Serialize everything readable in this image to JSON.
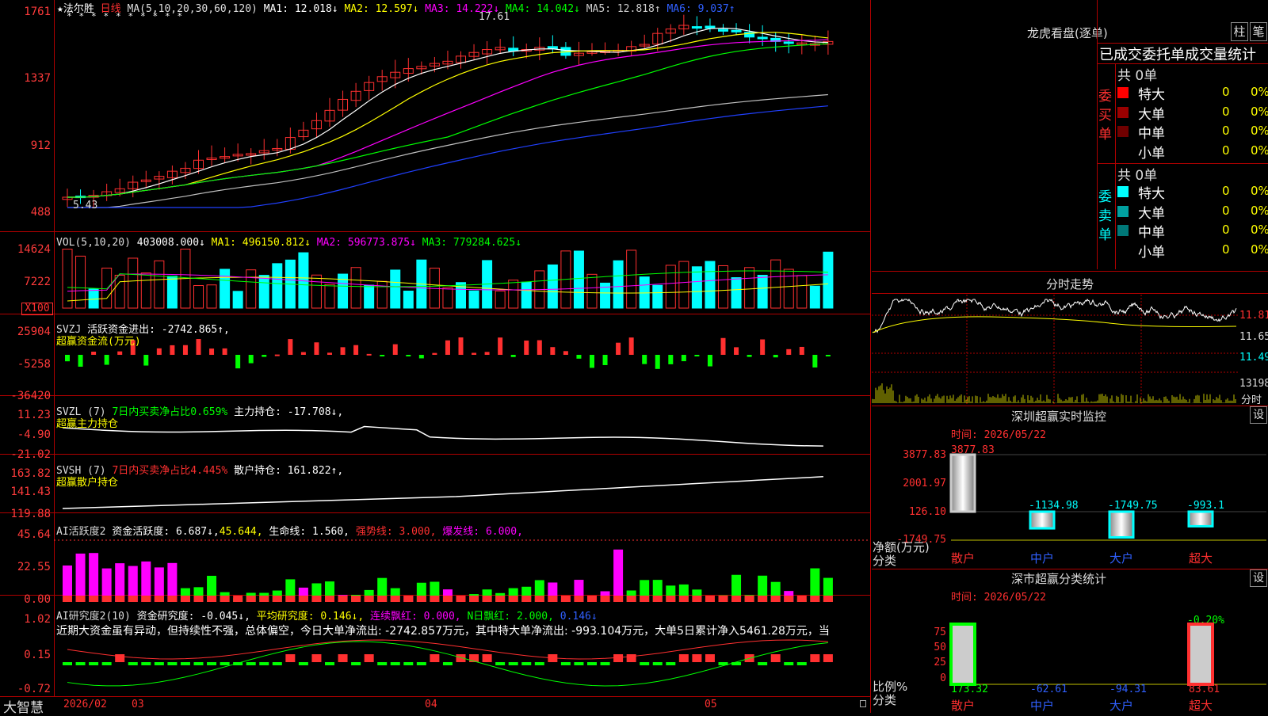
{
  "k_header": {
    "star": "★",
    "name": "法尔胜",
    "period": "日线",
    "ma_title": "MA(5,10,20,30,60,120)",
    "ma1": "MA1: 12.018↓",
    "ma2": "MA2: 12.597↓",
    "ma3": "MA3: 14.222↓",
    "ma4": "MA4: 14.042↓",
    "ma5": "MA5: 12.818↑",
    "ma6": "MA6: 9.037↑",
    "high_mark": "17.61",
    "low_mark": "5.43"
  },
  "k_axis": [
    "1761",
    "1337",
    "912",
    "488"
  ],
  "vol": {
    "title": "VOL(5,10,20)",
    "value": "403008.000↓",
    "ma1": "MA1: 496150.812↓",
    "ma2": "MA2: 596773.875↓",
    "ma3": "MA3: 779284.625↓",
    "axis": [
      "14624",
      "7222"
    ],
    "unit_btn": "X100"
  },
  "svzj": {
    "title": "SVZJ",
    "active": "活跃资金进出: -2742.865↑,",
    "sub": "超赢资金流(万元)",
    "axis": [
      "25904",
      "-5258",
      "-36420"
    ]
  },
  "svzl": {
    "title": "SVZL (7)",
    "ratio": "7日内买卖净占比0.659%",
    "pos": "主力持仓: -17.708↓,",
    "sub": "超赢主力持仓",
    "axis": [
      "11.23",
      "-4.90",
      "-21.02"
    ]
  },
  "svsh": {
    "title": "SVSH (7)",
    "ratio": "7日内买卖净占比4.445%",
    "pos": "散户持仓: 161.822↑,",
    "sub": "超赢散户持仓",
    "axis": [
      "163.82",
      "141.43",
      "119.88"
    ]
  },
  "ai2": {
    "title": "AI活跃度2",
    "act": "资金活跃度: 6.687↓,",
    "v2": "45.644,",
    "life": "生命线: 1.560,",
    "strong": "强势线: 3.000,",
    "burst": "爆发线: 6.000,",
    "axis": [
      "45.64",
      "22.55",
      "0.00"
    ]
  },
  "ai_res": {
    "title": "AI研究度2(10)",
    "res": "资金研究度: -0.045↓,",
    "avg": "平均研究度: 0.146↓,",
    "cont": "连续飘红: 0.000,",
    "nday": "N日飘红: 2.000,",
    "last": "0.146↓",
    "comment": "近期大资金虽有异动，但持续性不强，总体偏空，今日大单净流出: -2742.857万元，其中特大单净流出: -993.104万元，大单5日累计净入5461.28万元，当",
    "axis": [
      "1.02",
      "0.15",
      "-0.72"
    ]
  },
  "bottom": {
    "brand": "大智慧",
    "dates": [
      "2026/02",
      "03",
      "04",
      "05"
    ]
  },
  "longhu": {
    "title": "龙虎看盘(逐单)",
    "btn1": "柱",
    "btn2": "笔",
    "table_title": "已成交委托单成交量统计",
    "buy_label": "委买单",
    "sell_label": "委卖单",
    "buy_total": "共 0单",
    "sell_total": "共 0单",
    "buy_rows": [
      {
        "name": "特大",
        "count": "0",
        "pct": "0%",
        "color": "#ff0000"
      },
      {
        "name": "大单",
        "count": "0",
        "pct": "0%",
        "color": "#9a0000"
      },
      {
        "name": "中单",
        "count": "0",
        "pct": "0%",
        "color": "#700000"
      },
      {
        "name": "小单",
        "count": "0",
        "pct": "0%",
        "color": "#000000"
      }
    ],
    "sell_rows": [
      {
        "name": "特大",
        "count": "0",
        "pct": "0%",
        "color": "#00ffff"
      },
      {
        "name": "大单",
        "count": "0",
        "pct": "0%",
        "color": "#00a0a0"
      },
      {
        "name": "中单",
        "count": "0",
        "pct": "0%",
        "color": "#007878"
      },
      {
        "name": "小单",
        "count": "0",
        "pct": "0%",
        "color": "#000000"
      }
    ]
  },
  "intraday": {
    "title": "分时走势",
    "axis": [
      "11.81",
      "11.65",
      "11.49"
    ],
    "vol_top": "13198",
    "vol_unit": "分时"
  },
  "sz_monitor": {
    "title": "深圳超赢实时监控",
    "set": "设",
    "time": "时间: 2026/05/22",
    "axis": [
      "3877.83",
      "2001.97",
      "126.10",
      "-1749.75"
    ],
    "y_caption": "净额(万元)",
    "x_caption": "分类",
    "categories": [
      "散户",
      "中户",
      "大户",
      "超大"
    ],
    "values": [
      "3877.83",
      "-1134.98",
      "-1749.75",
      "-993.1"
    ]
  },
  "sz_class": {
    "title": "深市超赢分类统计",
    "set": "设",
    "time": "时间: 2026/05/22",
    "axis": [
      "75",
      "50",
      "25",
      "0"
    ],
    "y_caption": "比例%",
    "x_caption": "分类",
    "top_label": "-0.20%",
    "categories": [
      "散户",
      "中户",
      "大户",
      "超大"
    ],
    "values": [
      "173.32",
      "-62.61",
      "-94.31",
      "83.61"
    ]
  },
  "colors": {
    "up": "#ff3030",
    "down": "#00ffff",
    "grid": "#b00000"
  }
}
